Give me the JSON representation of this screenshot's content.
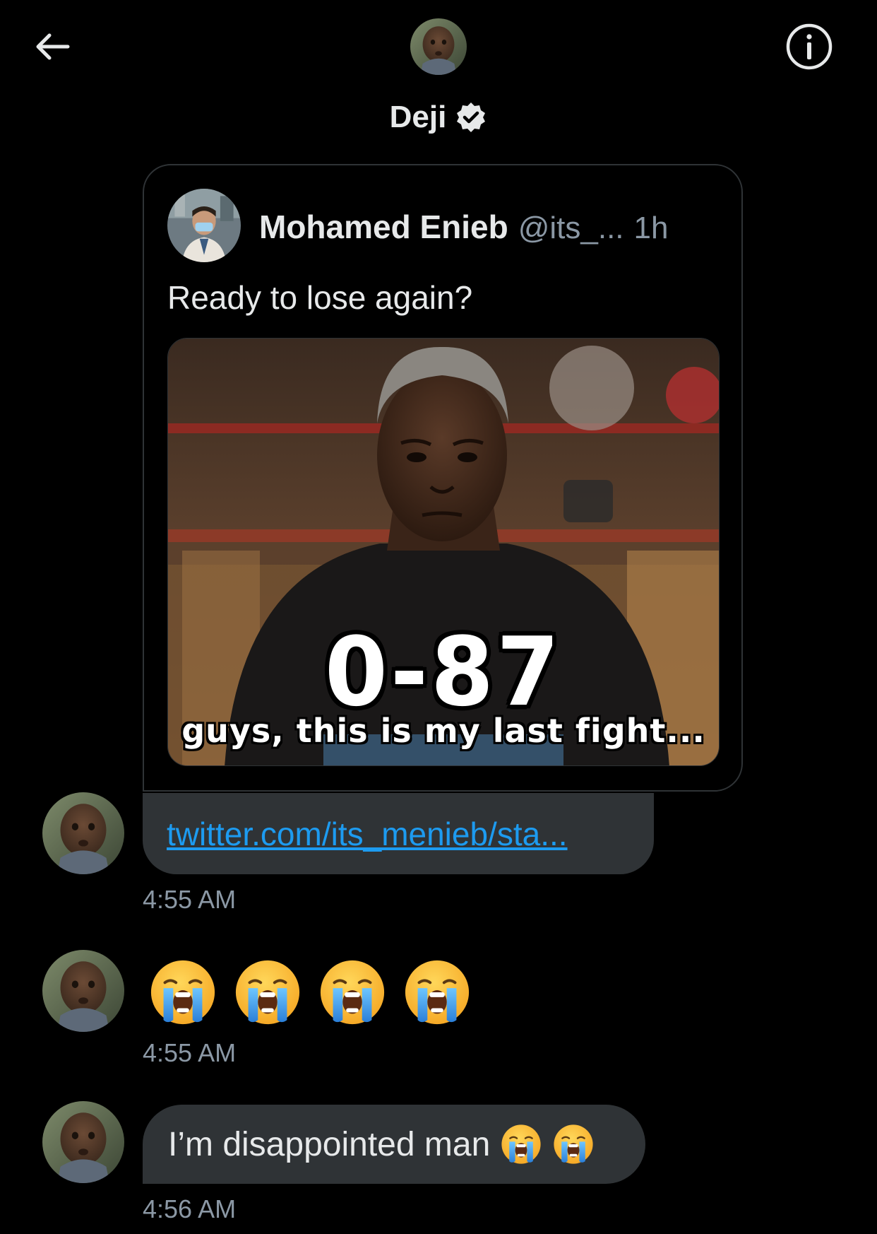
{
  "header": {
    "name": "Deji",
    "icons": {
      "back": "arrow-left-icon",
      "info": "info-circle-icon",
      "verified": "verified-badge-icon"
    }
  },
  "quote": {
    "author_name": "Mohamed Enieb",
    "handle": "@its_...",
    "time": "1h",
    "text": "Ready to lose again?",
    "media": {
      "caption_big": "0-87",
      "caption_small": "guys, this is my last fight..."
    }
  },
  "messages": [
    {
      "kind": "link",
      "text": "twitter.com/its_menieb/sta...",
      "time": "4:55 AM"
    },
    {
      "kind": "emoji",
      "emoji": [
        "😭",
        "😭",
        "😭",
        "😭"
      ],
      "emoji_name": "loudly-crying-face-icon",
      "time": "4:55 AM"
    },
    {
      "kind": "text",
      "text": "I’m disappointed man",
      "emoji": [
        "😭",
        "😭"
      ],
      "time": "4:56 AM"
    }
  ],
  "colors": {
    "background": "#000000",
    "bubble": "#2f3336",
    "link": "#1d9bf0",
    "muted": "#8b98a5",
    "text": "#e7e9ea"
  }
}
